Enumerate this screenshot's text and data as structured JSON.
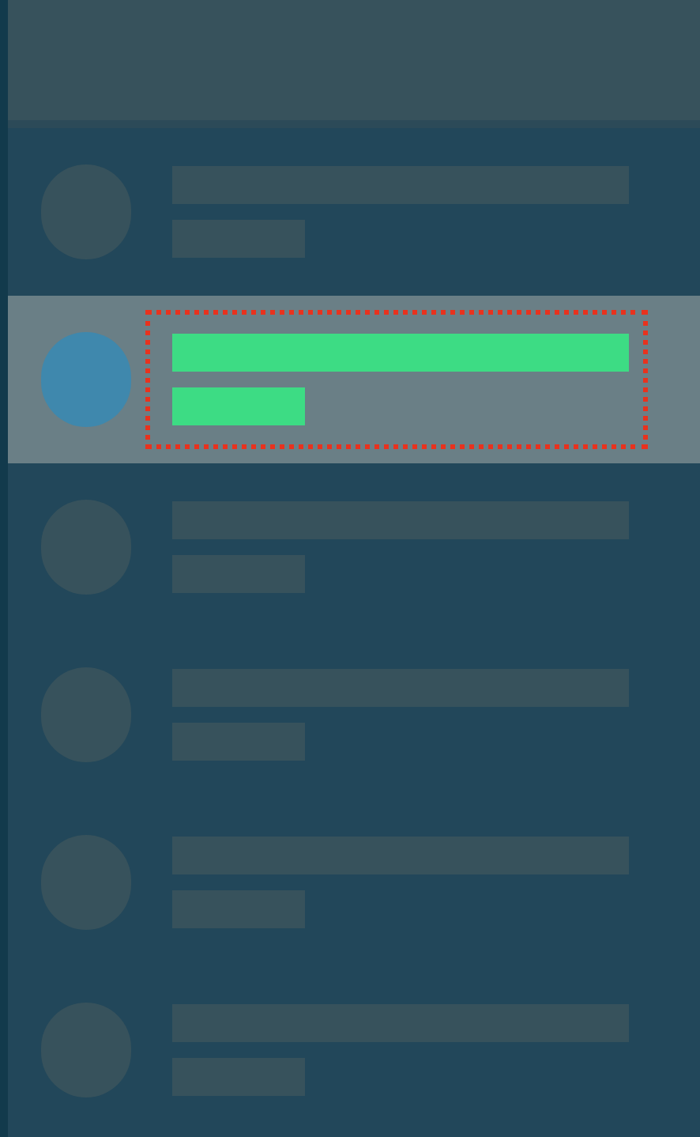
{
  "items": [
    {
      "selected": false
    },
    {
      "selected": true
    },
    {
      "selected": false
    },
    {
      "selected": false
    },
    {
      "selected": false
    },
    {
      "selected": false
    }
  ]
}
